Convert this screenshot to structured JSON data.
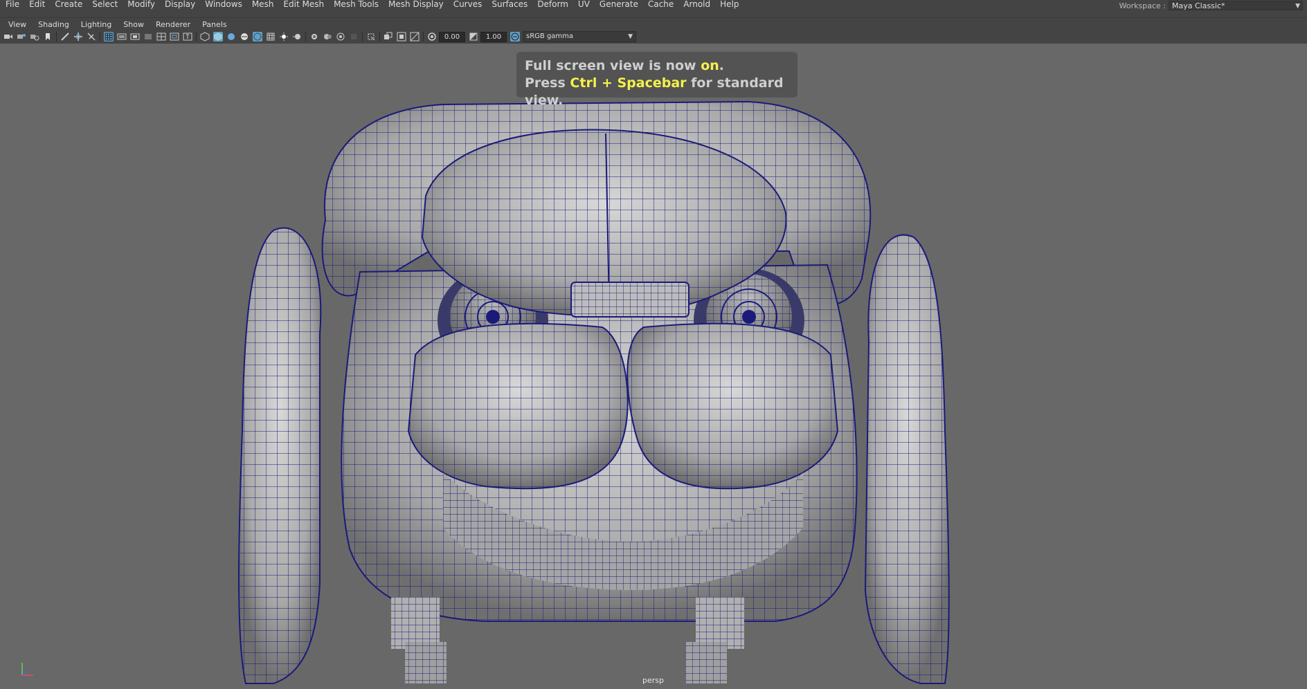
{
  "menubar": {
    "items": [
      "File",
      "Edit",
      "Create",
      "Select",
      "Modify",
      "Display",
      "Windows",
      "Mesh",
      "Edit Mesh",
      "Mesh Tools",
      "Mesh Display",
      "Curves",
      "Surfaces",
      "Deform",
      "UV",
      "Generate",
      "Cache",
      "Arnold",
      "Help"
    ],
    "workspace_label": "Workspace :",
    "workspace_value": "Maya Classic*"
  },
  "panel_menu": {
    "items": [
      "View",
      "Shading",
      "Lighting",
      "Show",
      "Renderer",
      "Panels"
    ]
  },
  "toolbar": {
    "exposure_value": "0.00",
    "gamma_value": "1.00",
    "colorspace_value": "sRGB gamma",
    "icons": [
      "select-camera-icon",
      "camera-attributes-icon",
      "bookmark-icon",
      "image-plane-icon",
      "grease-pencil-icon",
      "2d-pan-zoom-icon",
      "grid-icon",
      "film-gate-icon",
      "resolution-gate-icon",
      "gate-mask-icon",
      "field-chart-icon",
      "safe-action-icon",
      "safe-title-icon",
      "wireframe-icon",
      "smooth-shade-icon",
      "use-default-material-icon",
      "wireframe-on-shaded-icon",
      "xray-icon",
      "lighting-icon",
      "shadows-icon",
      "screen-space-ao-icon",
      "motion-blur-icon",
      "anti-aliasing-icon",
      "depth-of-field-icon",
      "isolate-select-icon",
      "xray-joints-icon",
      "xray-active-icon",
      "backface-culling-icon",
      "exposure-icon",
      "gamma-icon",
      "color-management-icon"
    ]
  },
  "viewport": {
    "hud_line1_pre": "Full screen view is now ",
    "hud_line1_hl": "on",
    "hud_line1_post": ".",
    "hud_line2_pre": "Press ",
    "hud_line2_hl": "Ctrl + Spacebar",
    "hud_line2_post": " for standard view.",
    "camera_name": "persp",
    "background_color": "#686868",
    "wire_color": "#1a1a7a"
  }
}
